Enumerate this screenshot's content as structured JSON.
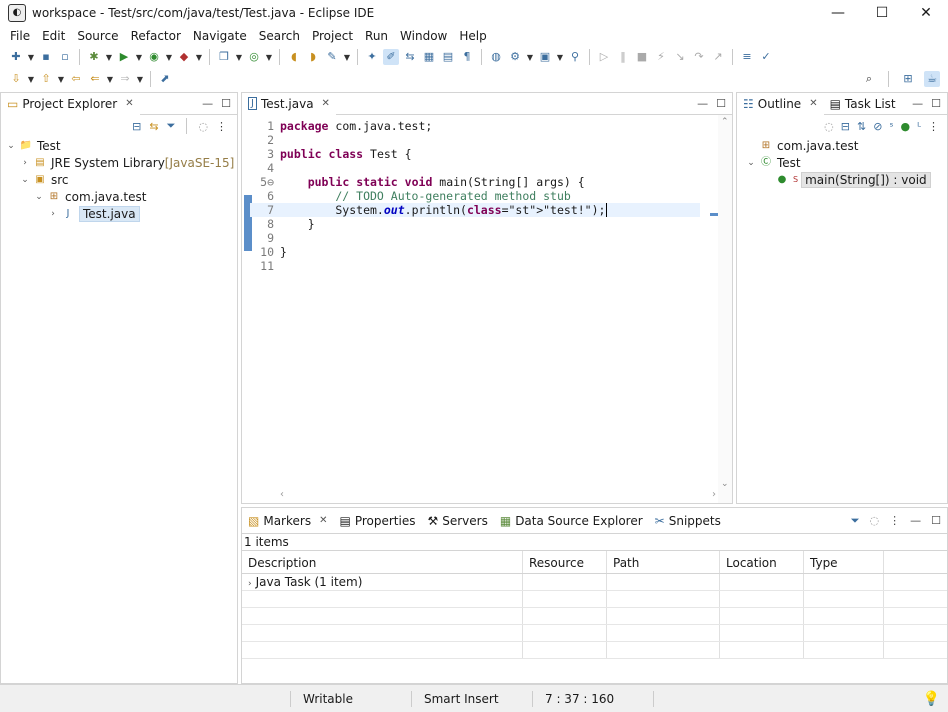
{
  "window": {
    "title": "workspace - Test/src/com/java/test/Test.java - Eclipse IDE",
    "minimize": "—",
    "maximize": "☐",
    "close": "✕"
  },
  "menu": [
    "File",
    "Edit",
    "Source",
    "Refactor",
    "Navigate",
    "Search",
    "Project",
    "Run",
    "Window",
    "Help"
  ],
  "project_explorer": {
    "tab_label": "Project Explorer",
    "tree": [
      {
        "level": 0,
        "twisty": "⌄",
        "icon": "project-icon",
        "glyph": "📁",
        "label": "Test"
      },
      {
        "level": 1,
        "twisty": "›",
        "icon": "library-icon",
        "glyph": "▤",
        "label": "JRE System Library",
        "suffix": "[JavaSE-15]"
      },
      {
        "level": 1,
        "twisty": "⌄",
        "icon": "source-folder-icon",
        "glyph": "▣",
        "label": "src"
      },
      {
        "level": 2,
        "twisty": "⌄",
        "icon": "package-icon",
        "glyph": "⊞",
        "label": "com.java.test"
      },
      {
        "level": 3,
        "twisty": "›",
        "icon": "java-file-icon",
        "glyph": "J",
        "label": "Test.java",
        "selected": true
      }
    ]
  },
  "editor": {
    "tab_label": "Test.java",
    "lines": [
      {
        "n": "1",
        "code": "package com.java.test;"
      },
      {
        "n": "2",
        "code": ""
      },
      {
        "n": "3",
        "code": "public class Test {"
      },
      {
        "n": "4",
        "code": ""
      },
      {
        "n": "5⊖",
        "code": "    public static void main(String[] args) {"
      },
      {
        "n": "6",
        "code": "        // TODO Auto-generated method stub"
      },
      {
        "n": "7",
        "code": "        System.out.println(\"test!\");"
      },
      {
        "n": "8",
        "code": "    }"
      },
      {
        "n": "9",
        "code": ""
      },
      {
        "n": "10",
        "code": "}"
      },
      {
        "n": "11",
        "code": ""
      }
    ]
  },
  "outline": {
    "tab_label": "Outline",
    "task_tab_label": "Task List",
    "items": [
      {
        "level": 0,
        "icon": "package-icon",
        "glyph": "⊞",
        "label": "com.java.test"
      },
      {
        "level": 0,
        "twisty": "⌄",
        "icon": "class-icon",
        "glyph": "Ⓒ",
        "label": "Test"
      },
      {
        "level": 1,
        "icon": "method-icon",
        "glyph": "●",
        "sup": "S",
        "label": "main(String[]) : void",
        "selected": true
      }
    ]
  },
  "bottom": {
    "tabs": [
      "Markers",
      "Properties",
      "Servers",
      "Data Source Explorer",
      "Snippets"
    ],
    "items_count": "1 items",
    "columns": [
      "Description",
      "Resource",
      "Path",
      "Location",
      "Type"
    ],
    "rows": [
      {
        "description": "Java Task (1 item)"
      }
    ]
  },
  "status": {
    "writable": "Writable",
    "insert_mode": "Smart Insert",
    "position": "7 : 37 : 160"
  },
  "colors": {
    "keyword": "#7f0055",
    "comment": "#3f7f5f",
    "string": "#2a00ff",
    "selection": "#d9e8f6",
    "current_line": "#e8f2fe"
  }
}
